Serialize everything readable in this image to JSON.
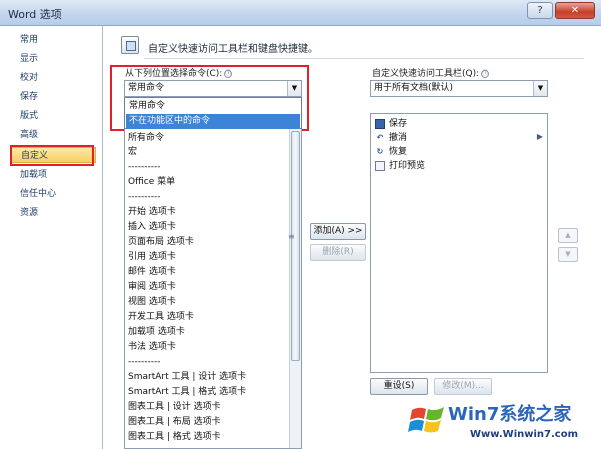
{
  "window": {
    "title": "Word 选项",
    "help_label": "?",
    "close_label": "✕"
  },
  "nav": {
    "items": [
      {
        "label": "常用"
      },
      {
        "label": "显示"
      },
      {
        "label": "校对"
      },
      {
        "label": "保存"
      },
      {
        "label": "版式"
      },
      {
        "label": "高级"
      },
      {
        "label": "自定义"
      },
      {
        "label": "加载项"
      },
      {
        "label": "信任中心"
      },
      {
        "label": "资源"
      }
    ],
    "selected": "自定义"
  },
  "header": {
    "text": "自定义快速访问工具栏和键盘快捷键。"
  },
  "left_panel": {
    "label": "从下列位置选择命令(C):",
    "info": "ⓘ",
    "combo_value": "常用命令",
    "dropdown_items": [
      "常用命令",
      "不在功能区中的命令"
    ],
    "dropdown_highlighted": "不在功能区中的命令",
    "list_items": [
      "所有命令",
      "宏",
      "----------",
      "Office 菜单",
      "----------",
      "开始 选项卡",
      "插入 选项卡",
      "页面布局 选项卡",
      "引用 选项卡",
      "邮件 选项卡",
      "审阅 选项卡",
      "视图 选项卡",
      "开发工具 选项卡",
      "加载项 选项卡",
      "书法 选项卡",
      "----------",
      "SmartArt 工具 | 设计 选项卡",
      "SmartArt 工具 | 格式 选项卡",
      "图表工具 | 设计 选项卡",
      "图表工具 | 布局 选项卡",
      "图表工具 | 格式 选项卡"
    ]
  },
  "middle": {
    "add_label": "添加(A) >>",
    "remove_label": "删除(R)"
  },
  "right_panel": {
    "label": "自定义快速访问工具栏(Q):",
    "info": "ⓘ",
    "combo_value": "用于所有文档(默认)",
    "items": [
      {
        "label": "保存",
        "icon": "save-icon"
      },
      {
        "label": "撤消",
        "icon": "undo-icon"
      },
      {
        "label": "恢复",
        "icon": "redo-icon"
      },
      {
        "label": "打印预览",
        "icon": "print-preview-icon"
      }
    ],
    "reset_label": "重设(S)",
    "modify_label": "修改(M)...",
    "up_label": "▲",
    "down_label": "▼"
  },
  "watermark": {
    "brand": "Win7系统之家",
    "url": "Www.Winwin7.com"
  },
  "colors": {
    "highlight": "#3d83d6",
    "selected_nav": "#f8cf63",
    "annotation_red": "#e0202a"
  }
}
